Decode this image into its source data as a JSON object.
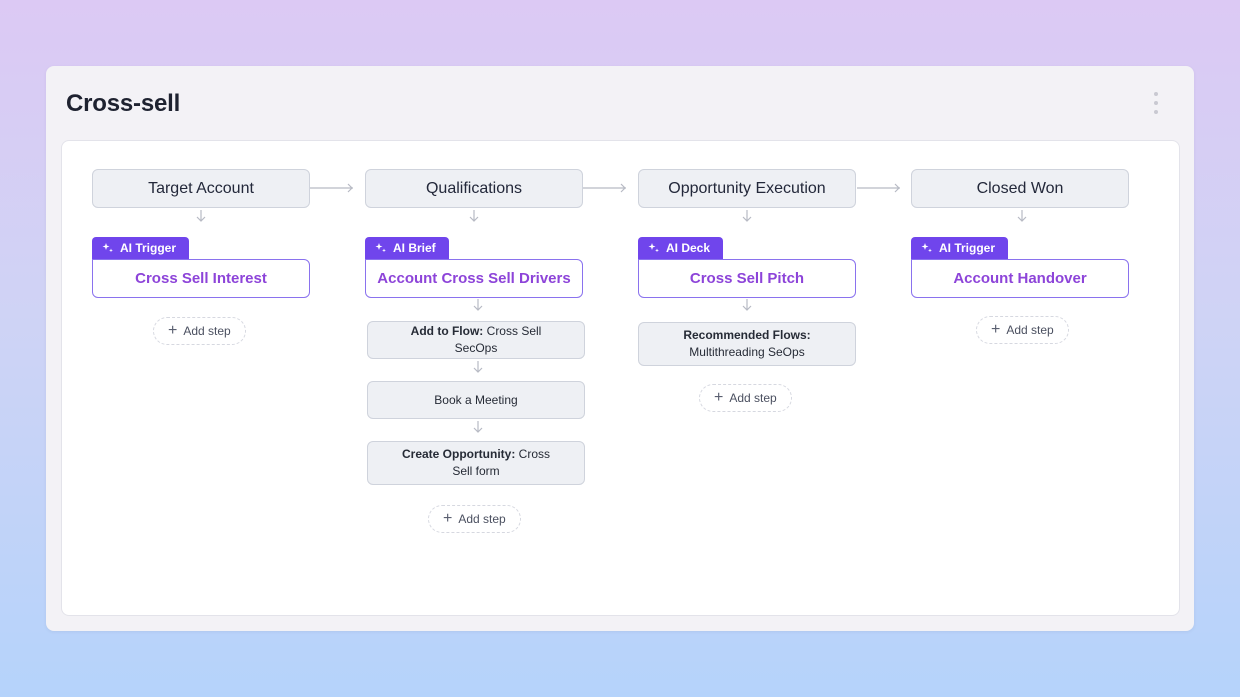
{
  "page": {
    "title": "Cross-sell"
  },
  "stages": [
    {
      "name": "Target Account",
      "tag": "AI Trigger",
      "card": "Cross Sell Interest",
      "steps": [],
      "add_step": "Add step"
    },
    {
      "name": "Qualifications",
      "tag": "AI Brief",
      "card": "Account Cross Sell Drivers",
      "steps": [
        {
          "bold": "Add to Flow:",
          "text": " Cross Sell SecOps"
        },
        {
          "bold": "",
          "text": "Book a Meeting"
        },
        {
          "bold": "Create Opportunity:",
          "text": " Cross Sell form"
        }
      ],
      "add_step": "Add step"
    },
    {
      "name": "Opportunity Execution",
      "tag": "AI Deck",
      "card": "Cross Sell Pitch",
      "steps": [
        {
          "bold": "Recommended Flows:",
          "text": " Multithreading SeOps"
        }
      ],
      "add_step": "Add step"
    },
    {
      "name": "Closed Won",
      "tag": "AI Trigger",
      "card": "Account Handover",
      "steps": [],
      "add_step": "Add step"
    }
  ],
  "icons": {
    "tag_icon": "sparkles-icon",
    "add_icon": "plus-icon",
    "menu_icon": "kebab-menu-icon"
  },
  "colors": {
    "tag_bg": "#7045ec",
    "card_text": "#8d44d9",
    "card_border": "#8a72ee"
  }
}
